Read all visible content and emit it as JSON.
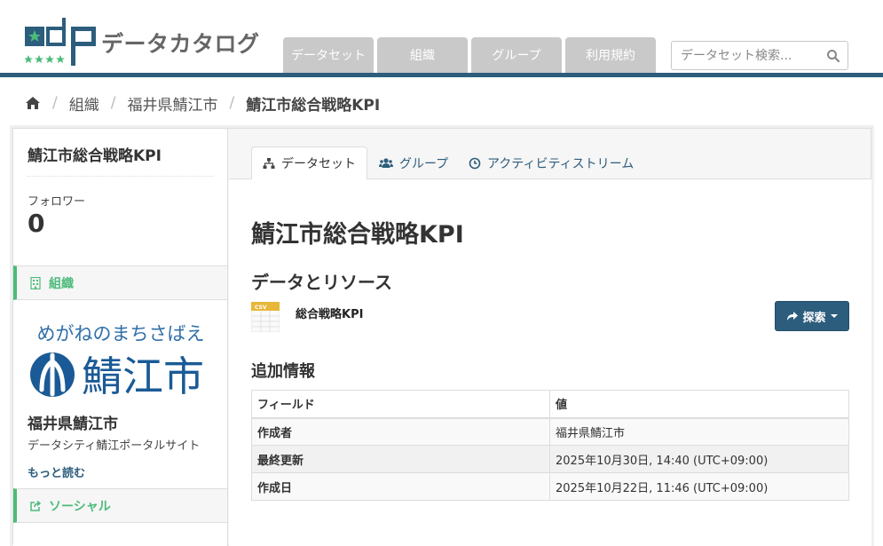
{
  "header": {
    "logo_text": "データカタログ",
    "nav": [
      "データセット",
      "組織",
      "グループ",
      "利用規約"
    ],
    "search_placeholder": "データセット検索..."
  },
  "breadcrumb": {
    "items": [
      "組織",
      "福井県鯖江市"
    ],
    "current": "鯖江市総合戦略KPI"
  },
  "sidebar": {
    "title": "鯖江市総合戦略KPI",
    "followers_label": "フォロワー",
    "followers_count": "0",
    "org_section_label": "組織",
    "org_image_caption": "めがねのまちさばえ",
    "org_image_city": "鯖江市",
    "org_name": "福井県鯖江市",
    "org_description": "データシティ鯖江ポータルサイト",
    "read_more": "もっと読む",
    "social_section_label": "ソーシャル"
  },
  "tabs": [
    {
      "label": "データセット",
      "icon": "sitemap-icon",
      "active": true
    },
    {
      "label": "グループ",
      "icon": "users-icon",
      "active": false
    },
    {
      "label": "アクティビティストリーム",
      "icon": "clock-icon",
      "active": false
    }
  ],
  "main": {
    "title": "鯖江市総合戦略KPI",
    "resources_heading": "データとリソース",
    "resource": {
      "name": "総合戦略KPI",
      "format": "CSV"
    },
    "explore_label": "探索",
    "additional_info_heading": "追加情報",
    "table": {
      "headers": [
        "フィールド",
        "値"
      ],
      "rows": [
        {
          "field": "作成者",
          "value": "福井県鯖江市"
        },
        {
          "field": "最終更新",
          "value": "2025年10月30日, 14:40 (UTC+09:00)"
        },
        {
          "field": "作成日",
          "value": "2025年10月22日, 11:46 (UTC+09:00)"
        }
      ]
    }
  },
  "colors": {
    "brand_blue": "#2c5d7c",
    "accent_green": "#4cbb7a",
    "nav_tab_gray": "#c9c9c9"
  }
}
